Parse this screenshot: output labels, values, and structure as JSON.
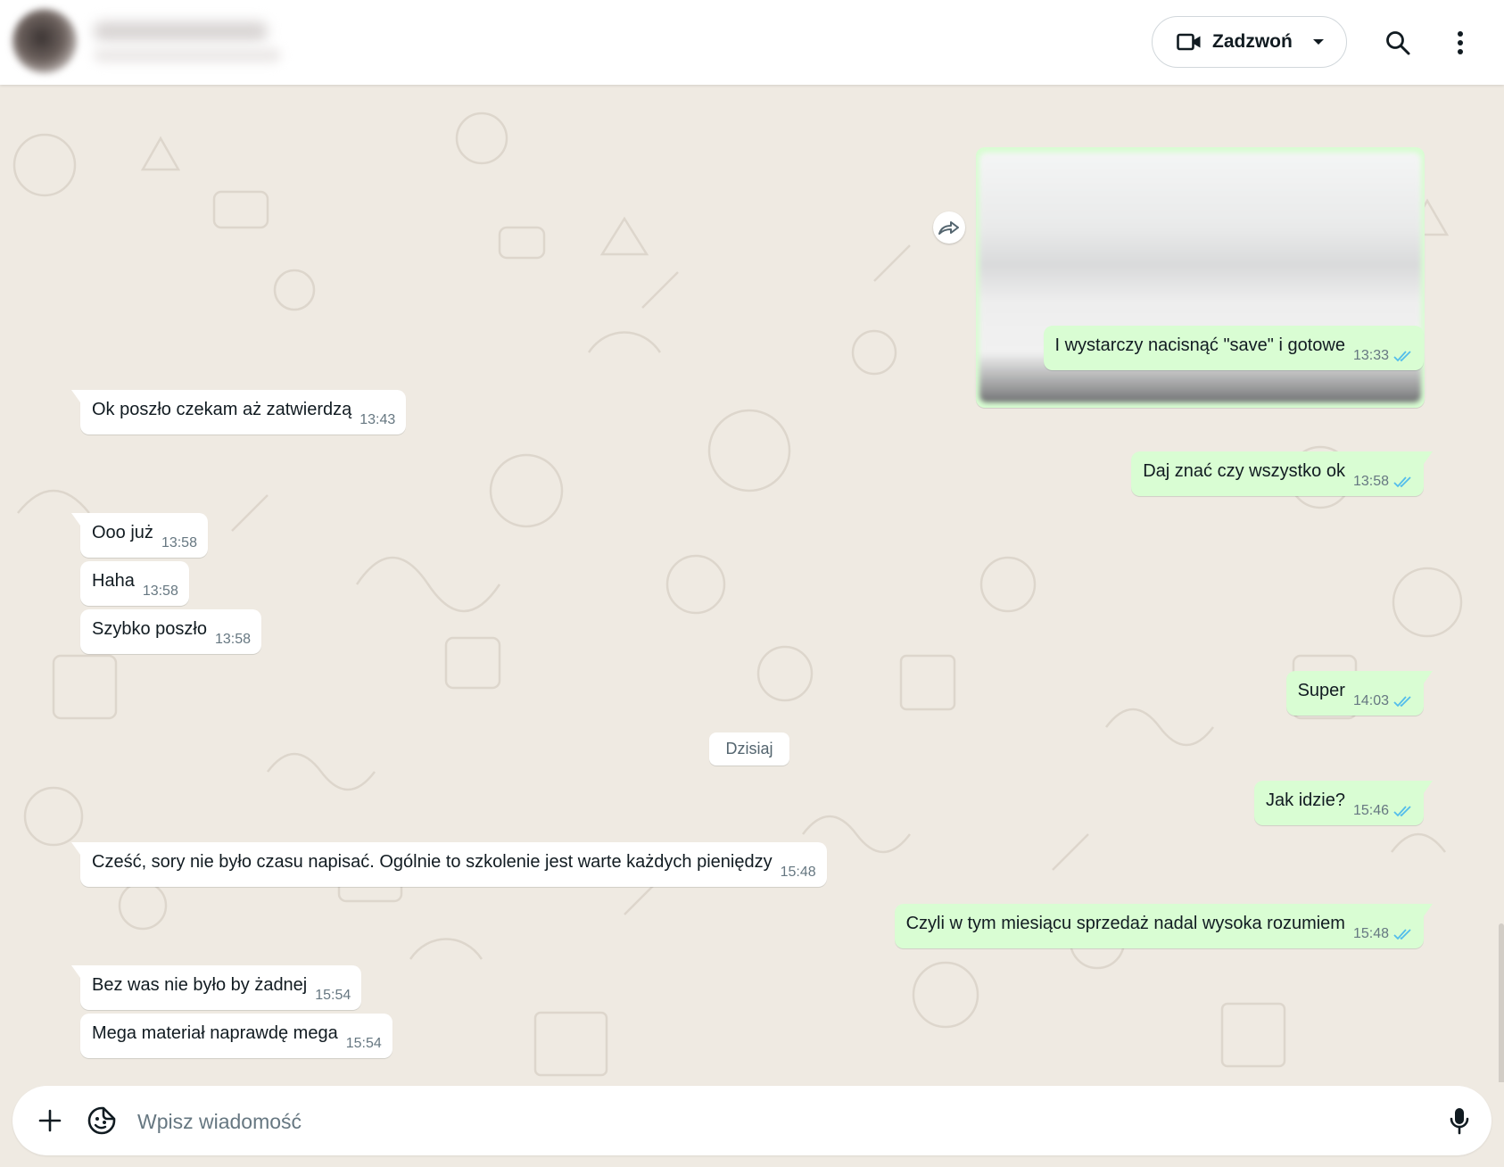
{
  "header": {
    "call_label": "Zadzwoń",
    "icons": [
      "video-camera-icon",
      "dropdown-arrow-icon",
      "search-icon",
      "more-menu-icon"
    ]
  },
  "chat": {
    "date_separator": "Dzisiaj",
    "messages": [
      {
        "id": "m1",
        "direction": "outgoing",
        "text": "I wystarczy nacisnąć \"save\" i gotowe",
        "time": "13:33",
        "status": "read"
      },
      {
        "id": "m2",
        "direction": "incoming",
        "text": "Ok poszło czekam aż zatwierdzą",
        "time": "13:43"
      },
      {
        "id": "m3",
        "direction": "outgoing",
        "text": "Daj znać czy wszystko ok",
        "time": "13:58",
        "status": "read"
      },
      {
        "id": "m4",
        "direction": "incoming",
        "text": "Ooo już",
        "time": "13:58"
      },
      {
        "id": "m5",
        "direction": "incoming",
        "text": "Haha",
        "time": "13:58"
      },
      {
        "id": "m6",
        "direction": "incoming",
        "text": "Szybko poszło",
        "time": "13:58"
      },
      {
        "id": "m7",
        "direction": "outgoing",
        "text": "Super",
        "time": "14:03",
        "status": "read"
      },
      {
        "id": "m8",
        "direction": "outgoing",
        "text": "Jak idzie?",
        "time": "15:46",
        "status": "read"
      },
      {
        "id": "m9",
        "direction": "incoming",
        "text": "Cześć, sory nie było czasu napisać. Ogólnie to szkolenie jest warte każdych pieniędzy",
        "time": "15:48"
      },
      {
        "id": "m10",
        "direction": "outgoing",
        "text": "Czyli w tym miesiącu sprzedaż nadal wysoka rozumiem",
        "time": "15:48",
        "status": "read"
      },
      {
        "id": "m11",
        "direction": "incoming",
        "text": "Bez was nie było by żadnej",
        "time": "15:54"
      },
      {
        "id": "m12",
        "direction": "incoming",
        "text": "Mega materiał naprawdę mega",
        "time": "15:54"
      }
    ]
  },
  "composer": {
    "placeholder": "Wpisz wiadomość",
    "icons": [
      "plus-icon",
      "sticker-icon",
      "microphone-icon"
    ]
  },
  "colors": {
    "chat_background": "#efeae2",
    "incoming_bubble": "#ffffff",
    "outgoing_bubble": "#d9fdd3",
    "read_ticks": "#53bdeb",
    "time_text": "#667781"
  }
}
